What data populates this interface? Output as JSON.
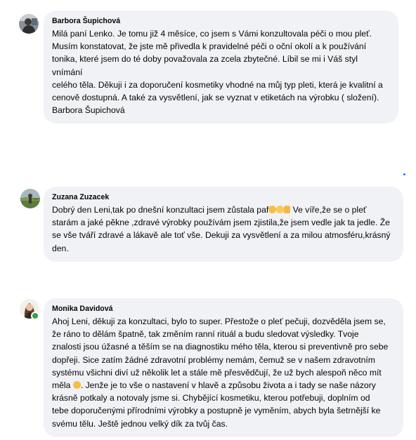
{
  "comments": [
    {
      "author": "Barbora Šupichová",
      "avatar": "person-photo-icon",
      "text": "Milá paní Lenko. Je tomu již 4 měsíce, co jsem s Vámi konzultovala péči o mou pleť.\nMusím konstatovat, že jste mě přivedla k pravidelné péči o oční okolí a k používání\ntonika, které jsem do té doby považovala za zcela zbytečné. Líbil se mi i Váš styl vnímání\ncelého těla. Děkuji i za doporučení kosmetiky vhodné na můj typ pleti, která je kvalitní a\ncenově dostupná. A také za vysvětlení, jak se vyznat v etiketách na výrobku ( složení).\nBarbora Šupichová"
    },
    {
      "author": "Zuzana Zuzacek",
      "avatar": "person-landscape-photo-icon",
      "text_before_emoji": "Dobrý den Leni,tak po dnešní konzultaci jsem zůstala paf",
      "emojis": [
        "face-with-hand-over-mouth-icon",
        "relieved-face-icon",
        "thumbs-up-icon"
      ],
      "text_after_emoji": " Ve víře,že se o pleť\nstarám a jaké pěkne ,zdravé výrobky používám jsem zjistila,že jsem vedle jak ta jedle. Že\nse vše tváří zdravé a lákavě ale toť vše. Dekuji za vysvětlení a za milou atmosféru,krásný\nden."
    },
    {
      "author": "Monika Davidová",
      "avatar": "person-photo-icon",
      "online": true,
      "text_before_emoji": "Ahoj Leni, děkuji za konzultaci, bylo to super. Přestože o pleť pečuji, dozvěděla jsem se,\nže ráno to dělám špatně, tak změním ranní rituál a budu sledovat výsledky. Tvoje\nznalosti jsou úžasné a těším se na diagnostiku mého těla, kterou si preventivně pro sebe\ndopřeji. Sice zatím žádné zdravotní problémy nemám, čemuž se v našem zdravotním\nsystému všichni diví už několik let a stále mě přesvědčují, že už bych alespoň něco mít\nměla ",
      "emojis": [
        "smiling-face-icon"
      ],
      "text_after_emoji": ". Jenže je to vše o nastavení v hlavě a způsobu života a i tady se naše názory\nkrásně potkaly a notovaly jsme si. Chybějící kosmetiku, kterou potřebuji, doplním od\ntebe doporučenými přírodními výrobky a postupně je vyměním, abych byla šetrnější ke\nsvému tělu. Ještě jednou velký dík za tvůj čas."
    }
  ],
  "colors": {
    "bubble": "#f0f2f5",
    "text": "#050505",
    "online": "#31a24c",
    "accent": "#1877f2"
  }
}
